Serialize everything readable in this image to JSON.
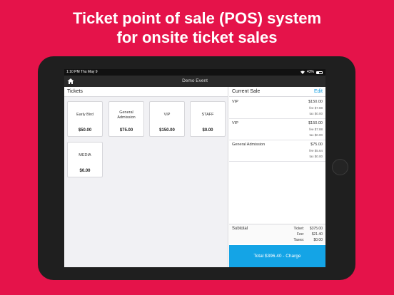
{
  "headline": {
    "line1": "Ticket point of sale (POS) system",
    "line2": "for onsite ticket sales"
  },
  "status_bar": {
    "time_date": "1:10 PM  Thu May 9",
    "battery": "43%"
  },
  "nav": {
    "title": "Demo Event",
    "home_icon": "home-icon"
  },
  "tickets_panel": {
    "title": "Tickets",
    "items": [
      {
        "name": "Early Bird",
        "price": "$50.00"
      },
      {
        "name": "General Admission",
        "price": "$75.00"
      },
      {
        "name": "VIP",
        "price": "$150.00"
      },
      {
        "name": "STAFF",
        "price": "$0.00"
      },
      {
        "name": "MEDIA",
        "price": "$0.00"
      }
    ]
  },
  "current_sale": {
    "title": "Current Sale",
    "edit_label": "Edit",
    "lines": [
      {
        "name": "VIP",
        "price": "$150.00",
        "fee": "fee $7.88",
        "tax": "tax $0.00"
      },
      {
        "name": "VIP",
        "price": "$150.00",
        "fee": "fee $7.88",
        "tax": "tax $0.00"
      },
      {
        "name": "General Admission",
        "price": "$75.00",
        "fee": "fee $5.64",
        "tax": "tax $0.00"
      }
    ],
    "subtotal_label": "Subtotal",
    "ticket_label": "Ticket:",
    "ticket_value": "$375.00",
    "fee_label": "Fee:",
    "fee_value": "$21.40",
    "taxes_label": "Taxes:",
    "taxes_value": "$0.00",
    "charge_label": "Total $396.40 - Charge"
  },
  "colors": {
    "background": "#e5134a",
    "accent": "#14a4e6"
  }
}
